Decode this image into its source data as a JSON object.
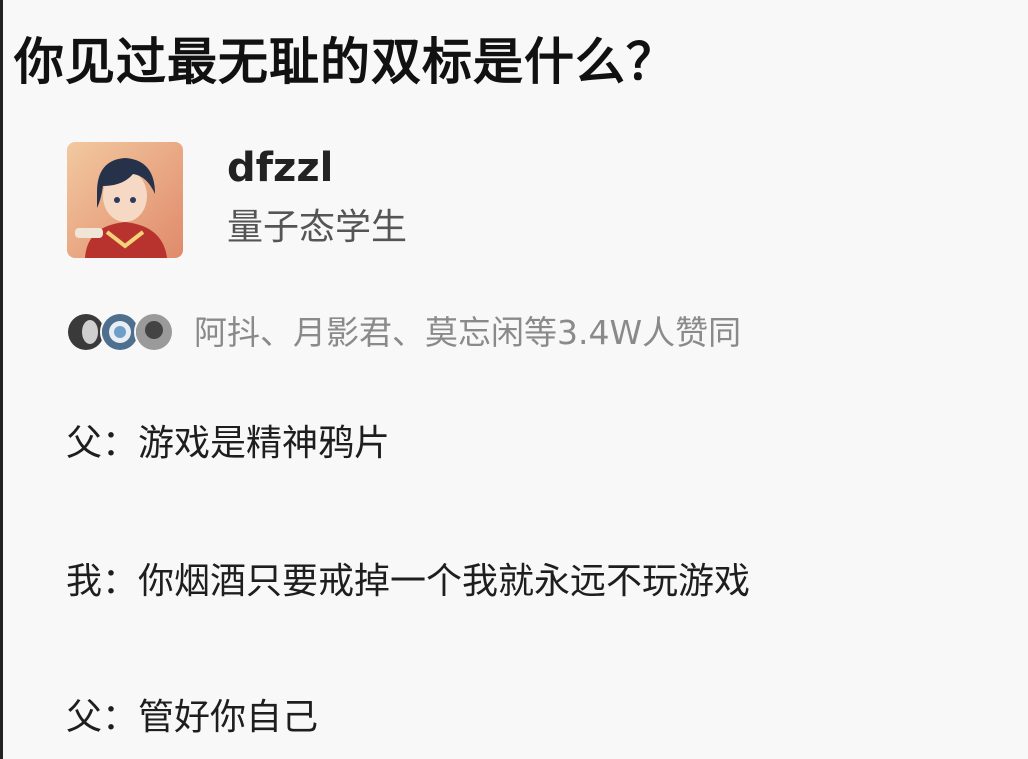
{
  "question": {
    "title": "你见过最无耻的双标是什么？"
  },
  "author": {
    "name": "dfzzl",
    "headline": "量子态学生"
  },
  "upvotes": {
    "text": "阿抖、月影君、莫忘闲等3.4W人赞同"
  },
  "dialogue": [
    {
      "speaker": "父",
      "separator": "：",
      "text": "游戏是精神鸦片"
    },
    {
      "speaker": "我",
      "separator": "：",
      "text": "你烟酒只要戒掉一个我就永远不玩游戏"
    },
    {
      "speaker": "父",
      "separator": "：",
      "text": "管好你自己"
    }
  ]
}
